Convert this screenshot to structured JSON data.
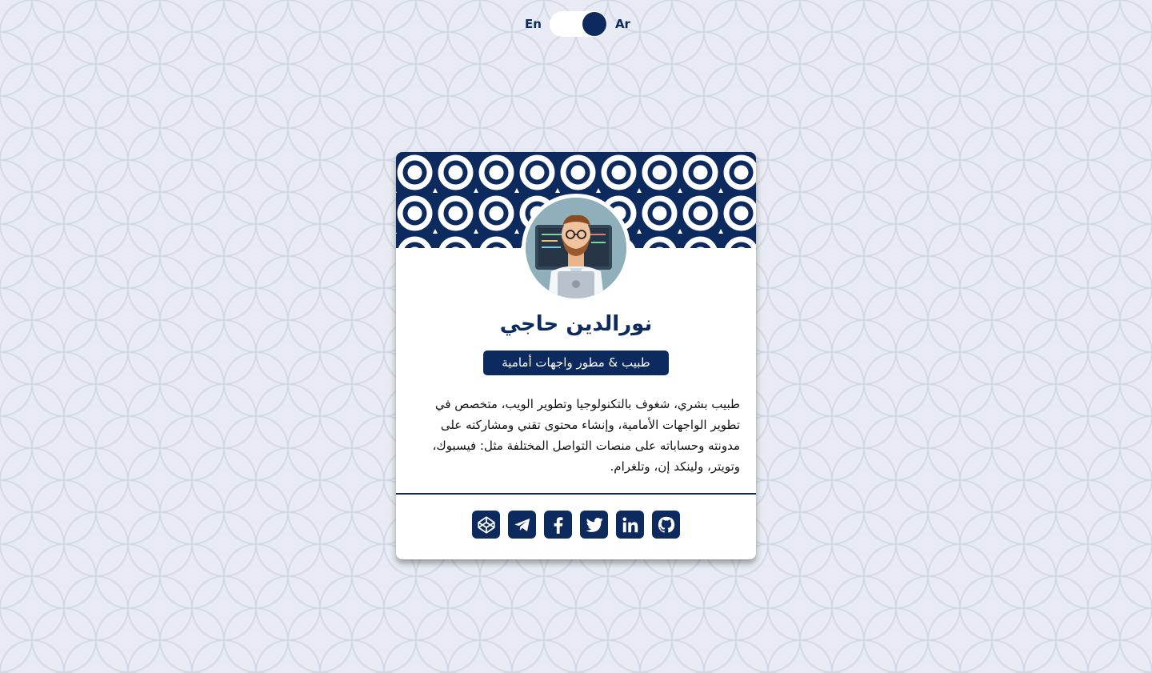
{
  "language_toggle": {
    "left_label": "En",
    "right_label": "Ar",
    "selected": "Ar"
  },
  "profile": {
    "name": "نورالدين حاجي",
    "role": "طبيب & مطور واجهات أمامية",
    "bio": "طبيب بشري، شغوف بالتكنولوجيا وتطوير الويب، متخصص في تطوير الواجهات الأمامية، وإنشاء محتوى تقني ومشاركته على مدونته وحساباته على منصات التواصل المختلفة مثل: فيسبوك، وتويتر، ولينكد إن، وتلغرام."
  },
  "social_links": [
    {
      "name": "codepen",
      "icon": "codepen-icon"
    },
    {
      "name": "telegram",
      "icon": "telegram-icon"
    },
    {
      "name": "facebook",
      "icon": "facebook-icon"
    },
    {
      "name": "twitter",
      "icon": "twitter-icon"
    },
    {
      "name": "linkedin",
      "icon": "linkedin-icon"
    },
    {
      "name": "github",
      "icon": "github-icon"
    }
  ],
  "colors": {
    "primary": "#0d2a5e",
    "background": "#e8ebf3",
    "card": "#ffffff"
  }
}
